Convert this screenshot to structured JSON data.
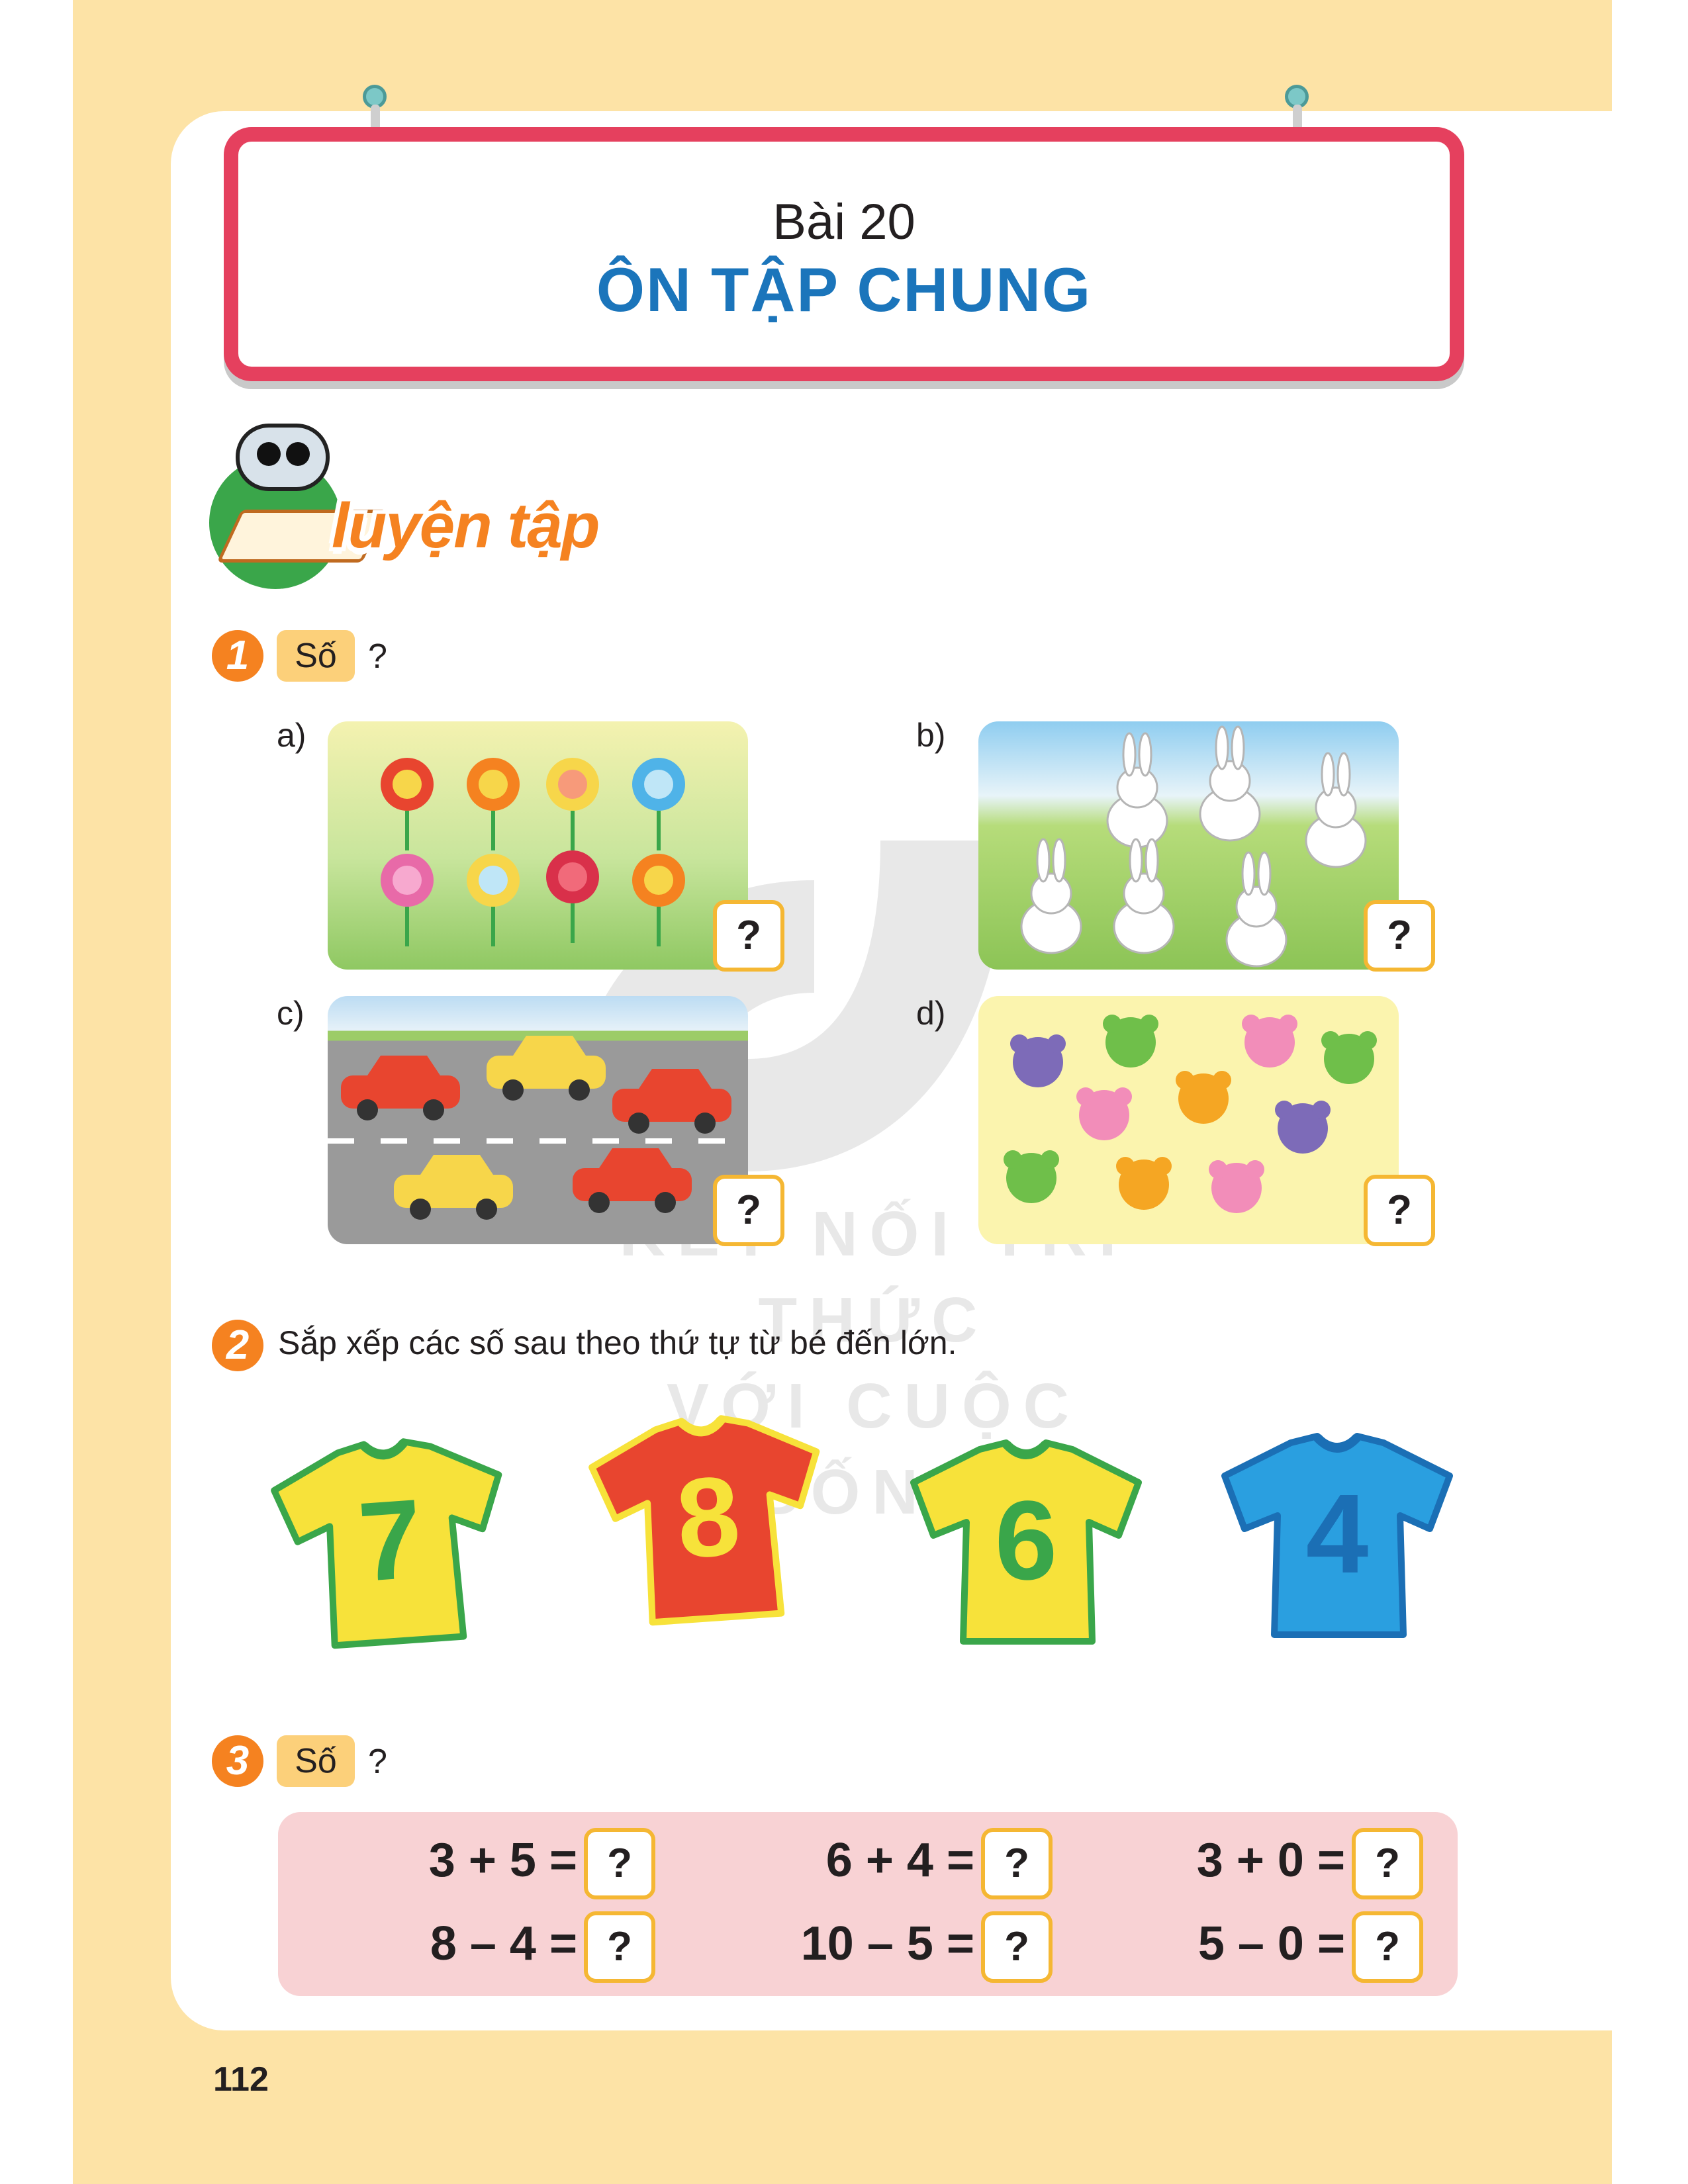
{
  "header": {
    "lesson_number": "Bài 20",
    "lesson_title": "ÔN TẬP CHUNG"
  },
  "practice": {
    "label": "luyện tập"
  },
  "exercise1": {
    "number": "1",
    "prompt": "Số",
    "question_mark": "?",
    "parts": [
      {
        "label": "a)",
        "answer": "?"
      },
      {
        "label": "b)",
        "answer": "?"
      },
      {
        "label": "c)",
        "answer": "?"
      },
      {
        "label": "d)",
        "answer": "?"
      }
    ]
  },
  "exercise2": {
    "number": "2",
    "instruction": "Sắp xếp các số sau theo thứ tự từ bé đến lớn.",
    "shirts": [
      {
        "number": "7",
        "color": "#f7e23a",
        "trim": "#3aa64a",
        "text_color": "#3aa64a"
      },
      {
        "number": "8",
        "color": "#e8452f",
        "trim": "#f7e23a",
        "text_color": "#f7e23a"
      },
      {
        "number": "6",
        "color": "#f7e23a",
        "trim": "#3aa64a",
        "text_color": "#3aa64a"
      },
      {
        "number": "4",
        "color": "#2a9fe0",
        "trim": "#1b6fb5",
        "text_color": "#1b6fb5"
      }
    ]
  },
  "exercise3": {
    "number": "3",
    "prompt": "Số",
    "question_mark": "?",
    "equations": [
      {
        "expr": "3 + 5 =",
        "answer": "?"
      },
      {
        "expr": "6 + 4 =",
        "answer": "?"
      },
      {
        "expr": "3 + 0 =",
        "answer": "?"
      },
      {
        "expr": "8 – 4 =",
        "answer": "?"
      },
      {
        "expr": "10 – 5 =",
        "answer": "?"
      },
      {
        "expr": "5 – 0 =",
        "answer": "?"
      }
    ]
  },
  "watermark": {
    "line1": "KẾT NỐI TRI THỨC",
    "line2": "VỚI CUỘC SỐNG"
  },
  "page_number": "112",
  "colors": {
    "page_background": "#fde3a6",
    "banner_border": "#e5405e",
    "title_blue": "#1b75bb",
    "accent_orange": "#f58220",
    "answer_box_border": "#f5b733",
    "equation_panel": "#f8d2d4"
  }
}
